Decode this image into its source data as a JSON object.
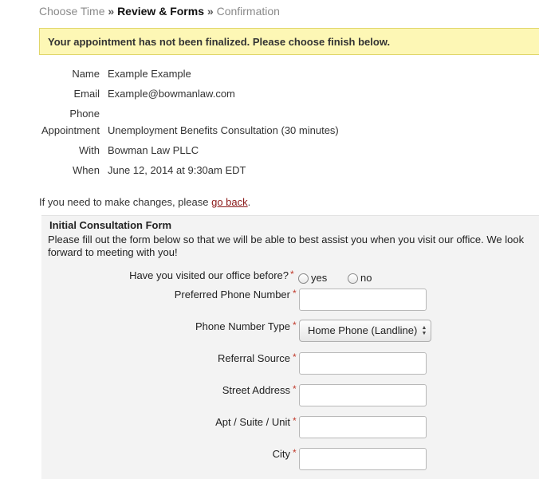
{
  "breadcrumb": {
    "step1": "Choose Time",
    "sep1": "»",
    "step2": "Review & Forms",
    "sep2": "»",
    "step3": "Confirmation"
  },
  "alert": {
    "text": "Your appointment has not been finalized. Please choose finish below."
  },
  "summary": {
    "name_label": "Name",
    "name_value": "Example Example",
    "email_label": "Email",
    "email_value": "Example@bowmanlaw.com",
    "phone_label": "Phone",
    "phone_value": "",
    "appointment_label": "Appointment",
    "appointment_value": "Unemployment Benefits Consultation (30 minutes)",
    "with_label": "With",
    "with_value": "Bowman Law PLLC",
    "when_label": "When",
    "when_value": "June 12, 2014 at 9:30am EDT"
  },
  "changes": {
    "prefix": "If you need to make changes, please ",
    "link": "go back",
    "suffix": "."
  },
  "form": {
    "title": "Initial Consultation Form",
    "description": "Please fill out the form below so that we will be able to best assist you when you visit our office. We look forward to meeting with you!",
    "required_mark": "*",
    "visited": {
      "label": "Have you visited our office before?",
      "opt_yes": "yes",
      "opt_no": "no"
    },
    "preferred_phone": {
      "label": "Preferred Phone Number",
      "value": ""
    },
    "phone_type": {
      "label": "Phone Number Type",
      "selected": "Home Phone (Landline)"
    },
    "referral": {
      "label": "Referral Source",
      "value": ""
    },
    "street": {
      "label": "Street Address",
      "value": ""
    },
    "apt": {
      "label": "Apt / Suite / Unit",
      "value": ""
    },
    "city": {
      "label": "City",
      "value": ""
    }
  }
}
